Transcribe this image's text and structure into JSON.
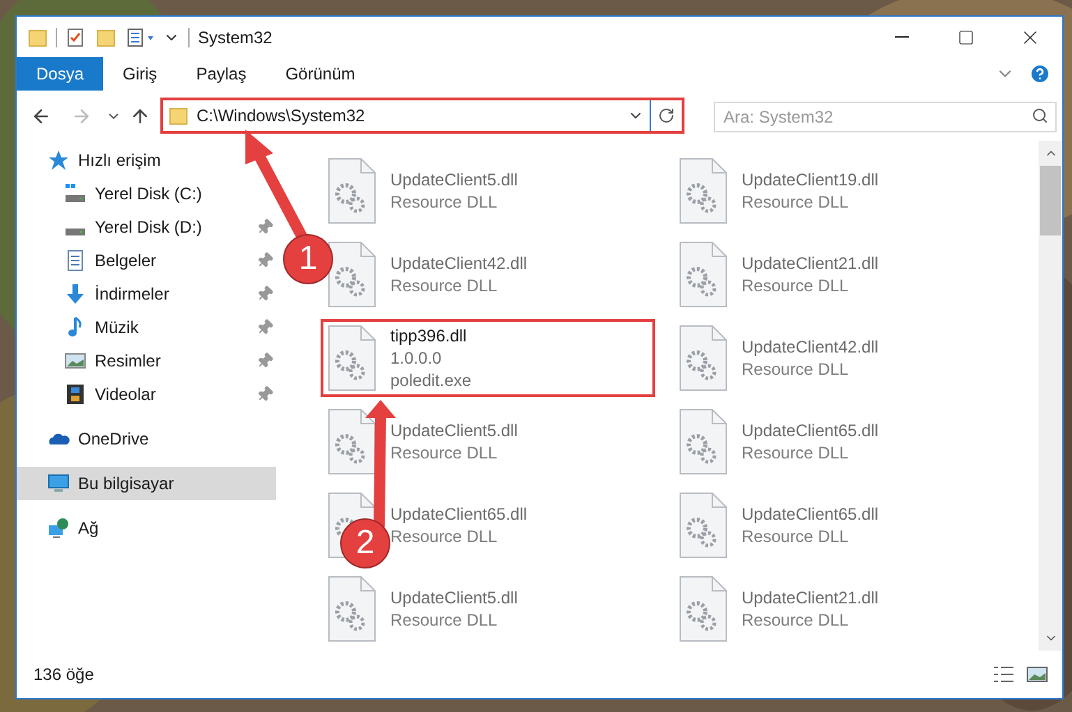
{
  "window": {
    "title": "System32"
  },
  "ribbon": {
    "tabs": [
      {
        "label": "Dosya",
        "selected": true
      },
      {
        "label": "Giriş",
        "selected": false
      },
      {
        "label": "Paylaş",
        "selected": false
      },
      {
        "label": "Görünüm",
        "selected": false
      }
    ]
  },
  "address_bar": {
    "path": "C:\\Windows\\System32",
    "highlighted": true
  },
  "search": {
    "placeholder": "Ara: System32"
  },
  "sidebar": {
    "items": [
      {
        "label": "Hızlı erişim",
        "kind": "star",
        "selected": false,
        "children": [
          {
            "label": "Yerel Disk (C:)",
            "kind": "drive-system",
            "pinned": false,
            "selected": false
          },
          {
            "label": "Yerel Disk (D:)",
            "kind": "drive",
            "pinned": true,
            "selected": false
          },
          {
            "label": "Belgeler",
            "kind": "documents",
            "pinned": true,
            "selected": false
          },
          {
            "label": "İndirmeler",
            "kind": "downloads",
            "pinned": true,
            "selected": false
          },
          {
            "label": "Müzik",
            "kind": "music",
            "pinned": true,
            "selected": false
          },
          {
            "label": "Resimler",
            "kind": "pictures",
            "pinned": true,
            "selected": false
          },
          {
            "label": "Videolar",
            "kind": "videos",
            "pinned": true,
            "selected": false
          }
        ]
      },
      {
        "label": "OneDrive",
        "kind": "cloud",
        "selected": false
      },
      {
        "label": "Bu bilgisayar",
        "kind": "computer",
        "selected": true
      },
      {
        "label": "Ağ",
        "kind": "network",
        "selected": false
      }
    ]
  },
  "files": [
    {
      "name": "UpdateClient5.dll",
      "lines": [
        "Resource DLL"
      ],
      "blurred": true,
      "highlighted": false,
      "selected": false
    },
    {
      "name": "UpdateClient19.dll",
      "lines": [
        "Resource DLL"
      ],
      "blurred": true,
      "highlighted": false,
      "selected": false
    },
    {
      "name": "UpdateClient42.dll",
      "lines": [
        "Resource DLL"
      ],
      "blurred": true,
      "highlighted": false,
      "selected": false
    },
    {
      "name": "UpdateClient21.dll",
      "lines": [
        "Resource DLL"
      ],
      "blurred": true,
      "highlighted": false,
      "selected": false
    },
    {
      "name": "tipp396.dll",
      "lines": [
        "1.0.0.0",
        "poledit.exe"
      ],
      "blurred": false,
      "highlighted": true,
      "selected": false
    },
    {
      "name": "UpdateClient42.dll",
      "lines": [
        "Resource DLL"
      ],
      "blurred": true,
      "highlighted": false,
      "selected": false
    },
    {
      "name": "UpdateClient5.dll",
      "lines": [
        "Resource DLL"
      ],
      "blurred": true,
      "highlighted": false,
      "selected": false
    },
    {
      "name": "UpdateClient65.dll",
      "lines": [
        "Resource DLL"
      ],
      "blurred": true,
      "highlighted": false,
      "selected": false
    },
    {
      "name": "UpdateClient65.dll",
      "lines": [
        "Resource DLL"
      ],
      "blurred": true,
      "highlighted": false,
      "selected": false
    },
    {
      "name": "UpdateClient65.dll",
      "lines": [
        "Resource DLL"
      ],
      "blurred": true,
      "highlighted": false,
      "selected": false
    },
    {
      "name": "UpdateClient5.dll",
      "lines": [
        "Resource DLL"
      ],
      "blurred": true,
      "highlighted": false,
      "selected": false
    },
    {
      "name": "UpdateClient21.dll",
      "lines": [
        "Resource DLL"
      ],
      "blurred": true,
      "highlighted": false,
      "selected": false
    }
  ],
  "status_bar": {
    "item_count": "136 öğe"
  },
  "annotations": [
    {
      "number": "1"
    },
    {
      "number": "2"
    }
  ]
}
